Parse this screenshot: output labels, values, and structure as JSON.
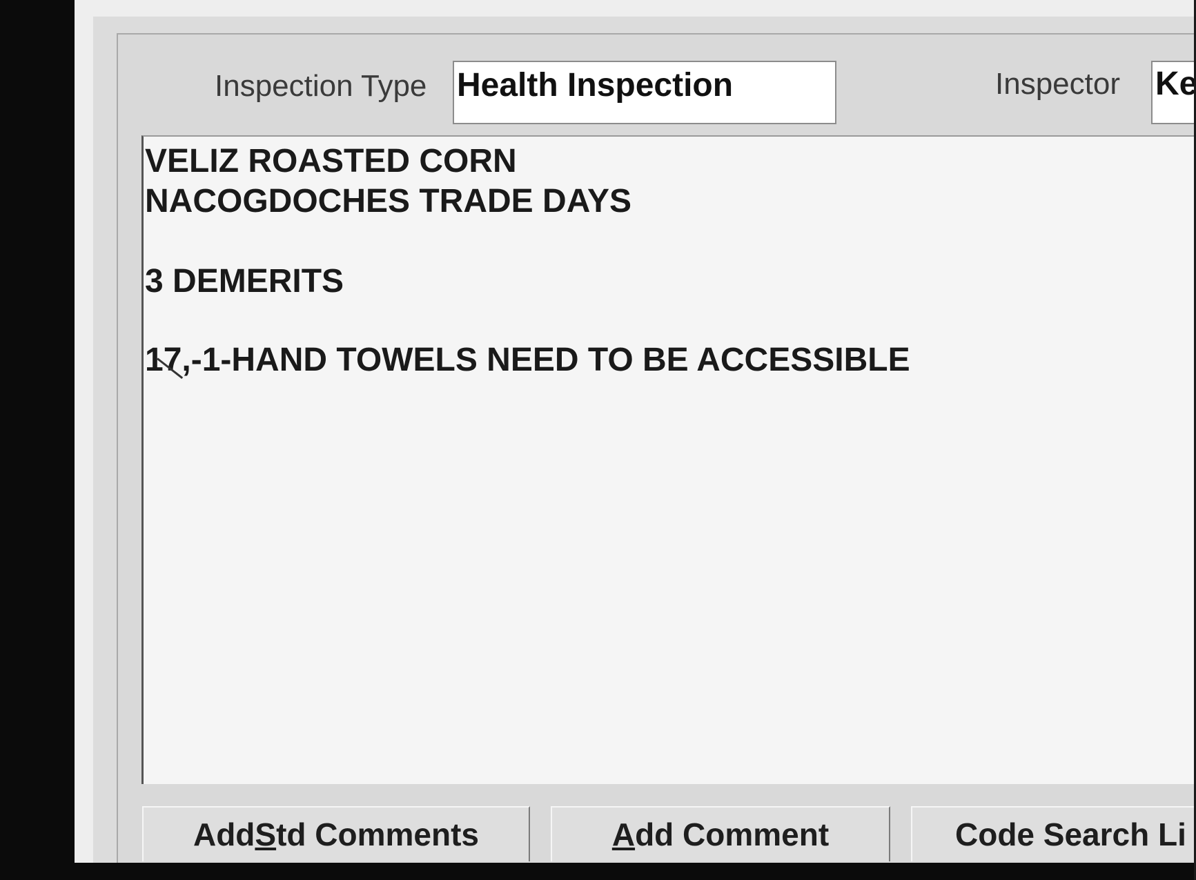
{
  "form": {
    "inspection_type_label": "Inspection Type",
    "inspection_type_value": "Health Inspection",
    "inspector_label": "Inspector",
    "inspector_value": "Ke"
  },
  "comments": {
    "lines": [
      "VELIZ ROASTED CORN",
      "NACOGDOCHES TRADE DAYS",
      "3 DEMERITS",
      "17,-1-HAND TOWELS NEED TO BE ACCESSIBLE"
    ]
  },
  "buttons": {
    "add_std_comments": {
      "pre": "Add ",
      "mnemonic": "S",
      "post": "td Comments"
    },
    "add_comment": {
      "pre": "",
      "mnemonic": "A",
      "post": "dd Comment"
    },
    "code_search": {
      "label": "Code Search Li"
    }
  }
}
